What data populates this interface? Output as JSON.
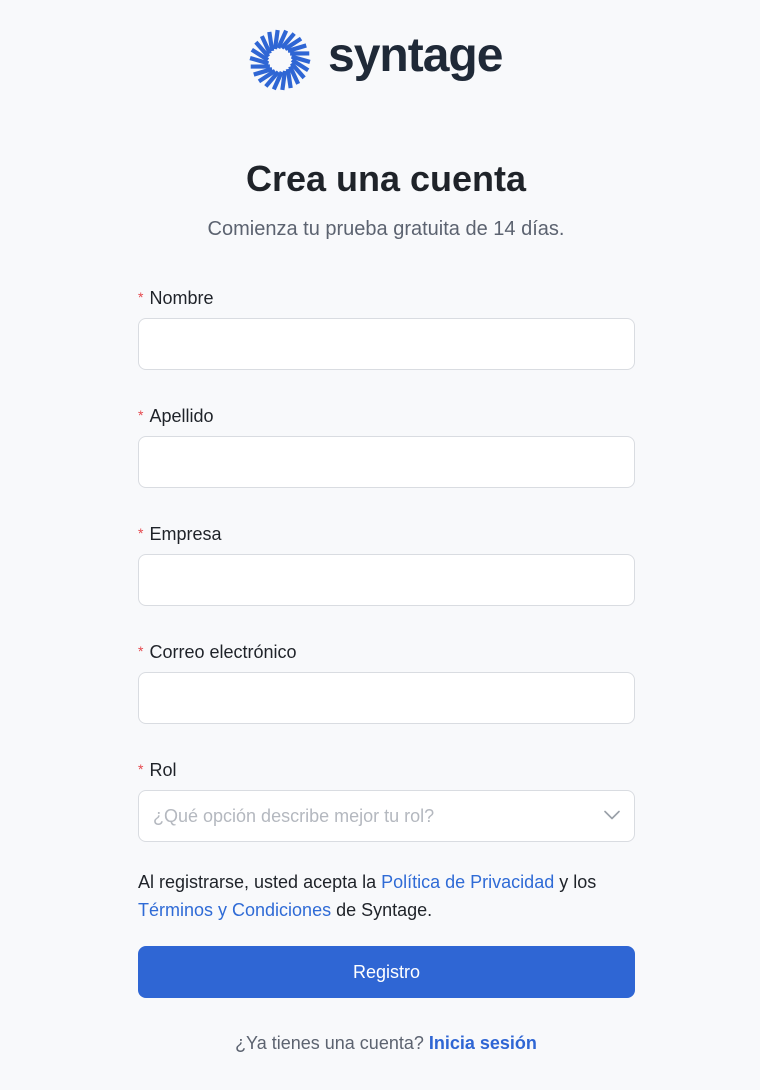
{
  "brand": {
    "name": "syntage",
    "logo_icon": "sunburst-logo-icon",
    "accent_color": "#2f66d4"
  },
  "header": {
    "title": "Crea una cuenta",
    "subtitle": "Comienza tu prueba gratuita de 14 días."
  },
  "form": {
    "required_marker": "*",
    "fields": [
      {
        "label": "Nombre",
        "value": "",
        "placeholder": ""
      },
      {
        "label": "Apellido",
        "value": "",
        "placeholder": ""
      },
      {
        "label": "Empresa",
        "value": "",
        "placeholder": ""
      },
      {
        "label": "Correo electrónico",
        "value": "",
        "placeholder": ""
      }
    ],
    "role": {
      "label": "Rol",
      "placeholder": "¿Qué opción describe mejor tu rol?",
      "icon": "chevron-down-icon"
    }
  },
  "terms": {
    "prefix": "Al registrarse, usted acepta la ",
    "privacy_link": "Política de Privacidad",
    "middle": " y los ",
    "terms_link": "Términos y Condiciones",
    "suffix": " de Syntage."
  },
  "submit": {
    "label": "Registro"
  },
  "footer": {
    "prompt": "¿Ya tienes una cuenta? ",
    "login_link": "Inicia sesión"
  }
}
